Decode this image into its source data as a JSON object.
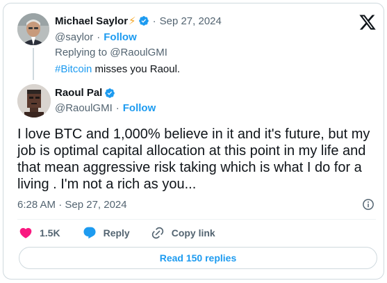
{
  "parent_tweet": {
    "display_name": "Michael Saylor",
    "name_emoji": "⚡",
    "date": "Sep 27, 2024",
    "handle": "@saylor",
    "separator": "·",
    "follow_label": "Follow",
    "replying_to": "Replying to @RaoulGMI",
    "text_hashtag": "#Bitcoin",
    "text_rest": " misses you Raoul."
  },
  "main_tweet": {
    "display_name": "Raoul Pal",
    "handle": "@RaoulGMI",
    "separator": "·",
    "follow_label": "Follow",
    "text": "I love BTC and 1,000% believe in it and it's future, but my job is optimal capital allocation at this point in my life and that mean aggressive risk taking which is what I do for a living . I'm not a rich as you...",
    "timestamp": "6:28 AM · Sep 27, 2024"
  },
  "actions": {
    "like_count": "1.5K",
    "reply_label": "Reply",
    "copy_link_label": "Copy link"
  },
  "read_replies_label": "Read 150 replies",
  "colors": {
    "accent": "#1d9bf0",
    "like": "#f91880",
    "secondary_text": "#536471",
    "border": "#cfd9de",
    "verified": "#1d9bf0"
  },
  "icons": [
    "x-logo-icon",
    "verified-badge-icon",
    "lightning-icon",
    "info-icon",
    "heart-icon",
    "reply-bubble-icon",
    "link-icon"
  ]
}
